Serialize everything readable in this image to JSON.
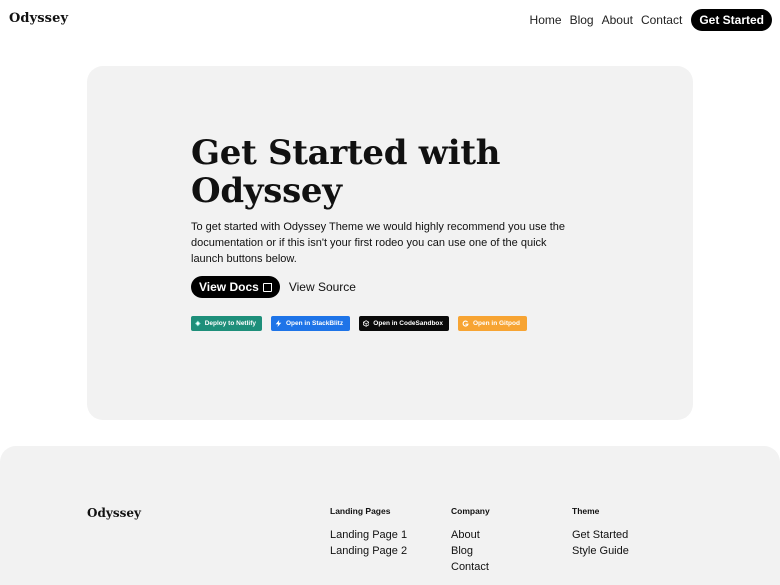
{
  "header": {
    "logo": "Odyssey",
    "nav": [
      "Home",
      "Blog",
      "About",
      "Contact"
    ],
    "cta": "Get Started"
  },
  "hero": {
    "title_line1": "Get Started with",
    "title_line2": "Odyssey",
    "text": "To get started with Odyssey Theme we would highly recommend you use the documentation or if this isn't your first rodeo you can use one of the quick launch buttons below.",
    "primary_button": "View Docs",
    "secondary_button": "View Source",
    "badges": [
      {
        "label": "Deploy to Netlify",
        "icon": "netlify-icon",
        "color": "#1e8f7a"
      },
      {
        "label": "Open in StackBlitz",
        "icon": "lightning-icon",
        "color": "#1e74e8"
      },
      {
        "label": "Open in CodeSandbox",
        "icon": "codesandbox-icon",
        "color": "#0a0a0a"
      },
      {
        "label": "Open in Gitpod",
        "icon": "gitpod-icon",
        "color": "#f7a433"
      }
    ]
  },
  "footer": {
    "logo": "Odyssey",
    "columns": [
      {
        "title": "Landing Pages",
        "links": [
          "Landing Page 1",
          "Landing Page 2"
        ]
      },
      {
        "title": "Company",
        "links": [
          "About",
          "Blog",
          "Contact"
        ]
      },
      {
        "title": "Theme",
        "links": [
          "Get Started",
          "Style Guide"
        ]
      }
    ]
  }
}
